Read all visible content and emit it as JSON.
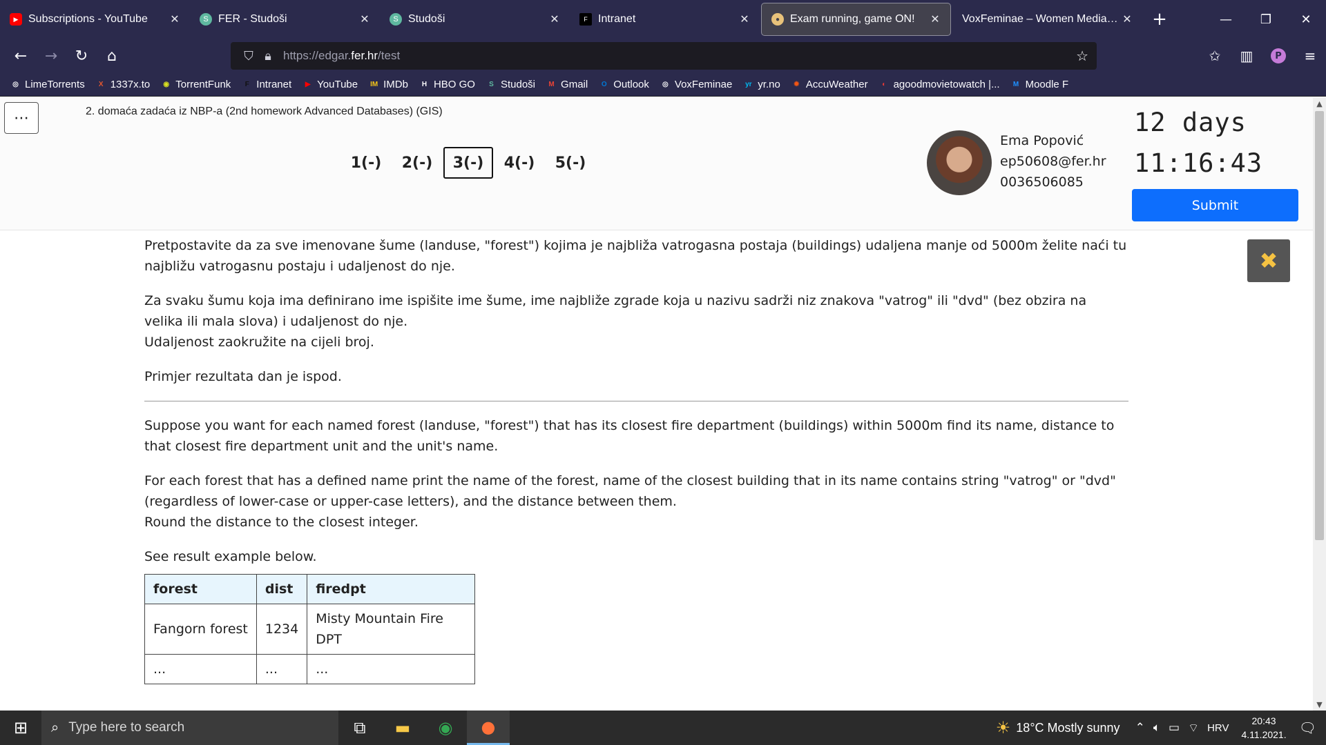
{
  "browser": {
    "tabs": [
      {
        "title": "Subscriptions - YouTube",
        "icon": "youtube-icon",
        "color": "#ff0000"
      },
      {
        "title": "FER - Studoši",
        "icon": "studosi-icon",
        "color": "#5fb8a0"
      },
      {
        "title": "Studoši",
        "icon": "studosi-icon",
        "color": "#5fb8a0"
      },
      {
        "title": "Intranet",
        "icon": "fer-icon",
        "color": "#000000"
      },
      {
        "title": "Exam running, game ON!",
        "icon": "edgar-icon",
        "color": "#e8c27a",
        "active": true
      },
      {
        "title": "VoxFeminae – Women Media Inde",
        "icon": "",
        "color": ""
      }
    ],
    "new_tab": "+",
    "url_prefix": "https://edgar.",
    "url_domain": "fer.hr",
    "url_suffix": "/test",
    "bookmarks": [
      {
        "label": "LimeTorrents",
        "icon": "globe-icon",
        "glyph": "◎",
        "color": "#ffffff"
      },
      {
        "label": "1337x.to",
        "icon": "x-icon",
        "glyph": "X",
        "color": "#e4572e"
      },
      {
        "label": "TorrentFunk",
        "icon": "torrentfunk-icon",
        "glyph": "◉",
        "color": "#d9e021"
      },
      {
        "label": "Intranet",
        "icon": "fer-icon",
        "glyph": "F",
        "color": "#111111"
      },
      {
        "label": "YouTube",
        "icon": "youtube-icon",
        "glyph": "▶",
        "color": "#ff0000"
      },
      {
        "label": "IMDb",
        "icon": "imdb-icon",
        "glyph": "IM",
        "color": "#f5c518"
      },
      {
        "label": "HBO GO",
        "icon": "hbo-icon",
        "glyph": "H",
        "color": "#ffffff"
      },
      {
        "label": "Studoši",
        "icon": "studosi-icon",
        "glyph": "S",
        "color": "#5fb8a0"
      },
      {
        "label": "Gmail",
        "icon": "gmail-icon",
        "glyph": "M",
        "color": "#ea4335"
      },
      {
        "label": "Outlook",
        "icon": "outlook-icon",
        "glyph": "O",
        "color": "#0078d4"
      },
      {
        "label": "VoxFeminae",
        "icon": "globe-icon",
        "glyph": "◎",
        "color": "#ffffff"
      },
      {
        "label": "yr.no",
        "icon": "yr-icon",
        "glyph": "yr",
        "color": "#00b8f1"
      },
      {
        "label": "AccuWeather",
        "icon": "accuweather-icon",
        "glyph": "✹",
        "color": "#f05514"
      },
      {
        "label": "agoodmovietowatch |...",
        "icon": "agood-icon",
        "glyph": "◐",
        "color": "#e53935"
      },
      {
        "label": "Moodle F",
        "icon": "moodle-icon",
        "glyph": "M",
        "color": "#1e90ff"
      }
    ]
  },
  "exam": {
    "title": "2. domaća zadaća iz NBP-a (2nd homework Advanced Databases) (GIS)",
    "questions": [
      "1(-)",
      "2(-)",
      "3(-)",
      "4(-)",
      "5(-)"
    ],
    "active_question": 2,
    "user": {
      "name": "Ema Popović",
      "email": "ep50608@fer.hr",
      "id": "0036506085"
    },
    "countdown": {
      "days": "12 days",
      "time": "11:16:43"
    },
    "submit_label": "Submit"
  },
  "question": {
    "hr_p1": "Pretpostavite da za sve imenovane šume (landuse, \"forest\") kojima je najbliža vatrogasna postaja (buildings) udaljena manje od 5000m želite naći tu najbližu vatrogasnu postaju i udaljenost do nje.",
    "hr_p2a": "Za svaku šumu koja ima definirano ime ispišite ime šume, ime najbliže zgrade koja u nazivu sadrži niz znakova \"vatrog\" ili \"dvd\" (bez obzira na velika ili mala slova) i udaljenost do nje.",
    "hr_p2b": "Udaljenost zaokružite na cijeli broj.",
    "hr_p3": "Primjer rezultata dan je ispod.",
    "en_p1": "Suppose you want for each named forest (landuse, \"forest\") that has its closest fire department (buildings) within 5000m find its name, distance to that closest fire department unit and the unit's name.",
    "en_p2a": "For each forest that has a defined name print the name of the forest, name of the closest building that in its name contains string \"vatrog\" or \"dvd\" (regardless of lower-case or upper-case letters), and the distance between them.",
    "en_p2b": "Round the distance to the closest integer.",
    "en_p3": "See result example below.",
    "table": {
      "headers": [
        "forest",
        "dist",
        "firedpt"
      ],
      "rows": [
        [
          "Fangorn forest",
          "1234",
          "Misty Mountain Fire DPT"
        ],
        [
          "...",
          "...",
          "..."
        ]
      ]
    }
  },
  "taskbar": {
    "search_placeholder": "Type here to search",
    "weather": "18°C  Mostly sunny",
    "language": "HRV",
    "time": "20:43",
    "date": "4.11.2021."
  }
}
